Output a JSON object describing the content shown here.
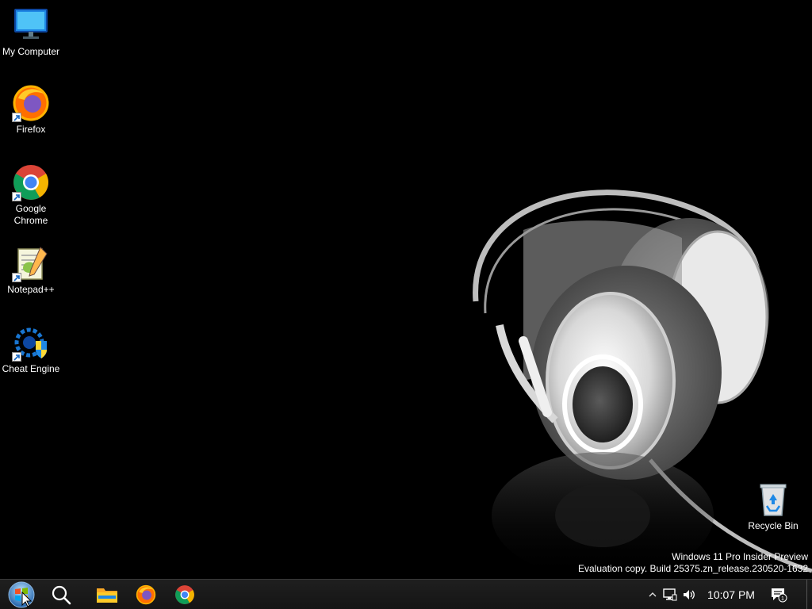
{
  "desktop": {
    "icons": [
      {
        "label": "My Computer",
        "icon": "monitor-icon"
      },
      {
        "label": "Firefox",
        "icon": "firefox-icon",
        "shortcut": true
      },
      {
        "label": "Google Chrome",
        "icon": "chrome-icon",
        "shortcut": true
      },
      {
        "label": "Notepad++",
        "icon": "notepadpp-icon",
        "shortcut": true
      },
      {
        "label": "Cheat Engine",
        "icon": "cheat-engine-icon",
        "shortcut": true
      }
    ],
    "recycle_bin": {
      "label": "Recycle Bin",
      "icon": "recycle-bin-icon"
    },
    "watermark": {
      "line1": "Windows 11 Pro Insider Preview",
      "line2": "Evaluation copy. Build 25375.zn_release.230520-1632"
    },
    "wallpaper": "headphones-wallpaper"
  },
  "taskbar": {
    "start": {
      "icon": "windows-orb-icon"
    },
    "search": {
      "icon": "search-icon"
    },
    "pinned": [
      {
        "name": "File Explorer",
        "icon": "folder-icon"
      },
      {
        "name": "Firefox",
        "icon": "firefox-icon"
      },
      {
        "name": "Google Chrome",
        "icon": "chrome-icon"
      }
    ],
    "tray": {
      "overflow_icon": "chevron-up-icon",
      "network_icon": "network-icon",
      "volume_icon": "speaker-icon",
      "clock": "10:07 PM",
      "notification_icon": "notification-icon",
      "notification_count": "1"
    }
  },
  "colors": {
    "taskbar_bg": "#1a1a1a",
    "desktop_bg": "#000000",
    "text": "#ffffff"
  }
}
